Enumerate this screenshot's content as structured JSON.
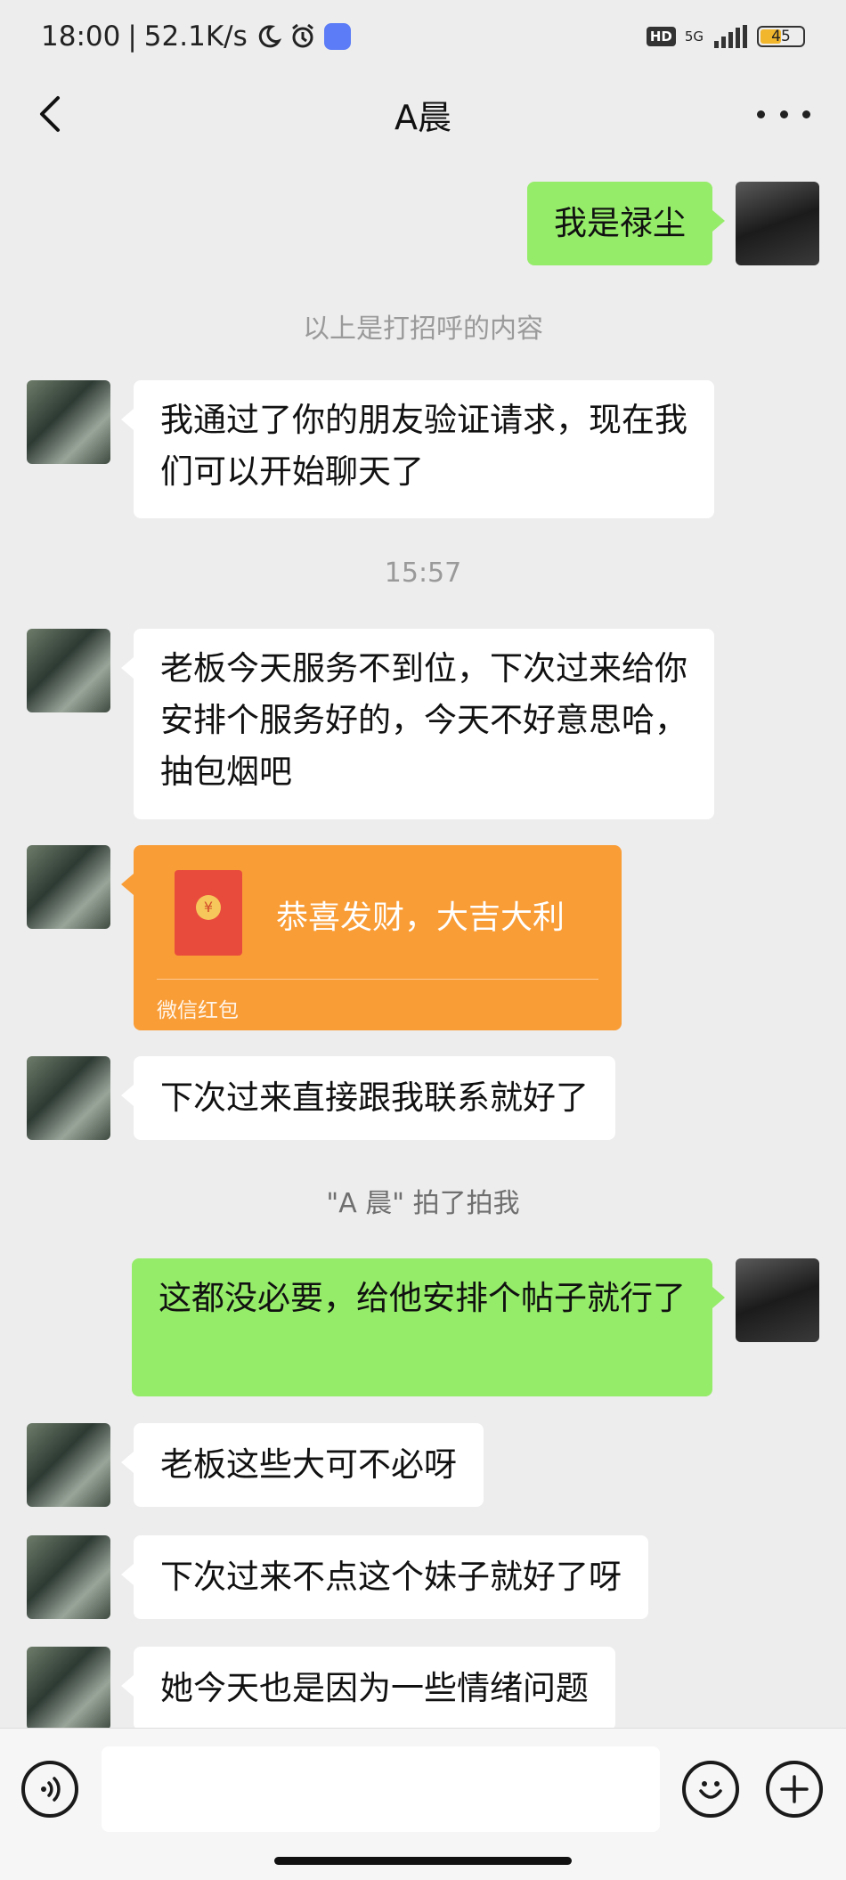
{
  "status_bar": {
    "time": "18:00",
    "separator": "|",
    "network_speed": "52.1K/s",
    "hd_label": "HD",
    "network_type": "5G",
    "battery_level": "45"
  },
  "header": {
    "title": "A晨",
    "icons": {
      "back": "chevron-left-icon",
      "more": "more-dots-icon"
    }
  },
  "messages": {
    "m1_self": "我是禄尘",
    "sys_greeting": "以上是打招呼的内容",
    "m2_other": "我通过了你的朋友验证请求，现在我们可以开始聊天了",
    "timestamp": "15:57",
    "m3_other": "老板今天服务不到位，下次过来给你安排个服务好的，今天不好意思哈，抽包烟吧",
    "red_packet": {
      "greeting": "恭喜发财，大吉大利",
      "footer": "微信红包",
      "coin_symbol": "¥",
      "color": "#f99d37"
    },
    "m4_other": "下次过来直接跟我联系就好了",
    "sys_pat": "\"A 晨\" 拍了拍我",
    "m5_self": "这都没必要，给他安排个帖子就行了",
    "m6_other": "老板这些大可不必呀",
    "m7_other": "下次过来不点这个妹子就好了呀",
    "m8_other": "她今天也是因为一些情绪问题"
  },
  "colors": {
    "self_bubble": "#95ec69",
    "other_bubble": "#ffffff",
    "background": "#ededed"
  },
  "input_bar": {
    "icons": {
      "voice": "voice-icon",
      "emoji": "emoji-icon",
      "plus": "plus-icon"
    }
  }
}
